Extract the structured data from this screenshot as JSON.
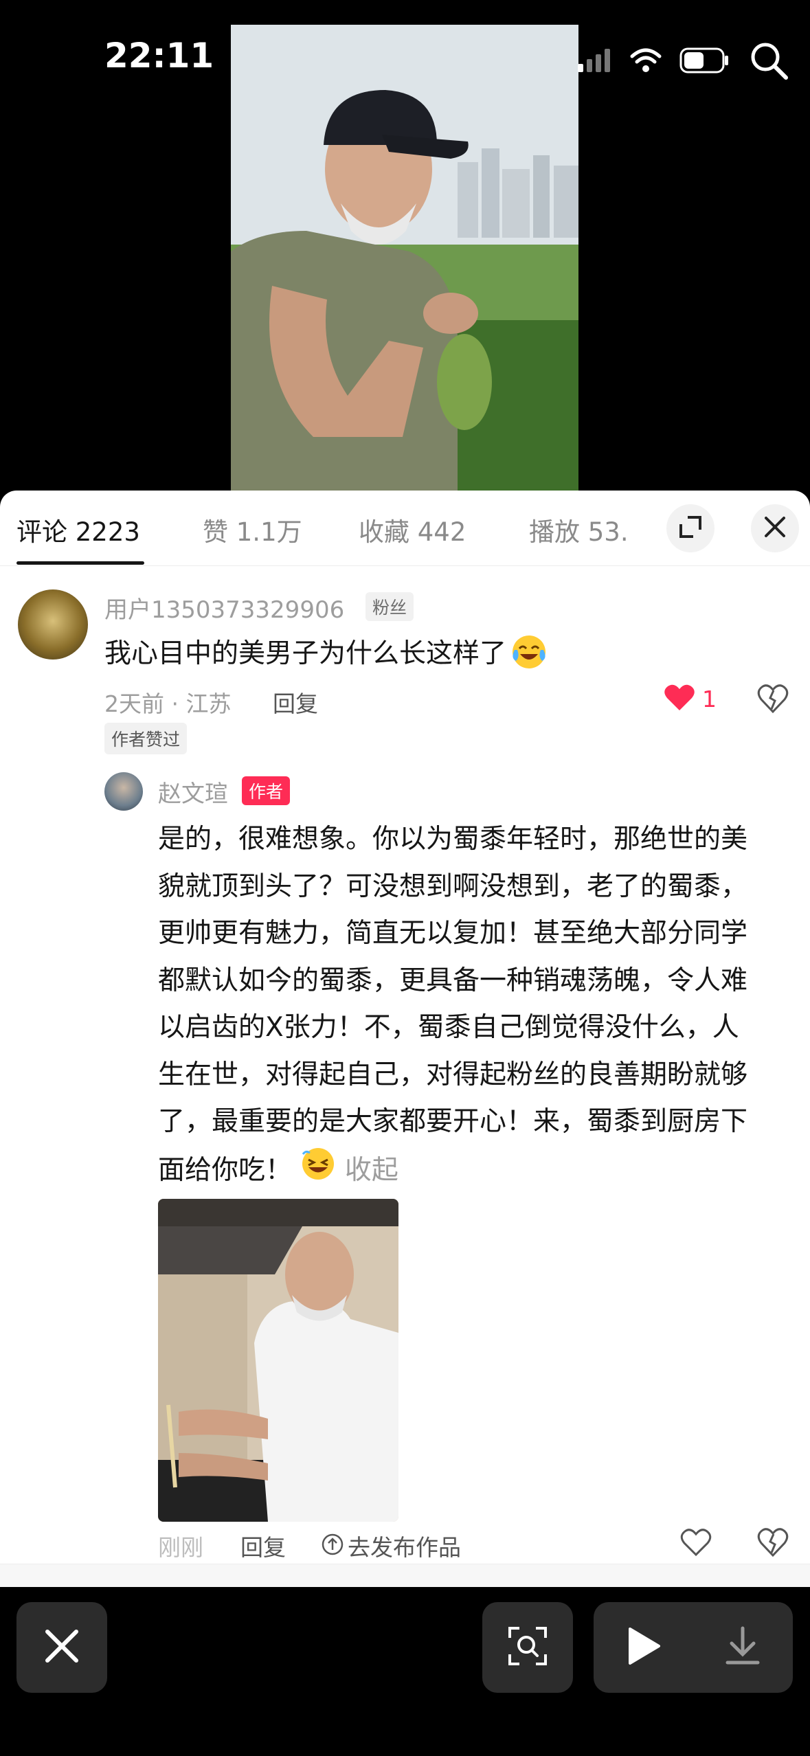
{
  "status_bar": {
    "time": "22:11"
  },
  "tabs": [
    {
      "label": "评论 2223",
      "active": true
    },
    {
      "label": "赞 1.1万",
      "active": false
    },
    {
      "label": "收藏 442",
      "active": false
    },
    {
      "label": "播放 53.",
      "active": false
    }
  ],
  "comment": {
    "username": "用户1350373329906",
    "badge": "粉丝",
    "text": "我心目中的美男子为什么长这样了",
    "meta": "2天前 · 江苏",
    "reply_label": "回复",
    "like_count": "1",
    "author_liked": "作者赞过"
  },
  "reply": {
    "username": "赵文瑄",
    "badge": "作者",
    "lines": [
      "是的，很难想象。你以为蜀黍年轻时，那绝世的美",
      "貌就顶到头了？可没想到啊没想到，老了的蜀黍，",
      "更帅更有魅力，简直无以复加！甚至绝大部分同学",
      "都默认如今的蜀黍，更具备一种销魂荡魄，令人难",
      "以启齿的X张力！不，蜀黍自己倒觉得没什么，人",
      "生在世，对得起自己，对得起粉丝的良善期盼就够",
      "了，最重要的是大家都要开心！来，蜀黍到厨房下",
      "面给你吃！"
    ],
    "collapse_label": "收起",
    "meta": "刚刚",
    "reply_label": "回复",
    "publish_label": "去发布作品"
  },
  "colors": {
    "accent": "#fe2c55",
    "text": "#161616",
    "muted": "#9d9d9d"
  },
  "icons": [
    "expand-icon",
    "close-icon",
    "heart-icon",
    "dislike-icon",
    "laugh-emoji-icon",
    "cry-laugh-emoji-icon",
    "scan-icon",
    "play-icon",
    "download-icon"
  ]
}
